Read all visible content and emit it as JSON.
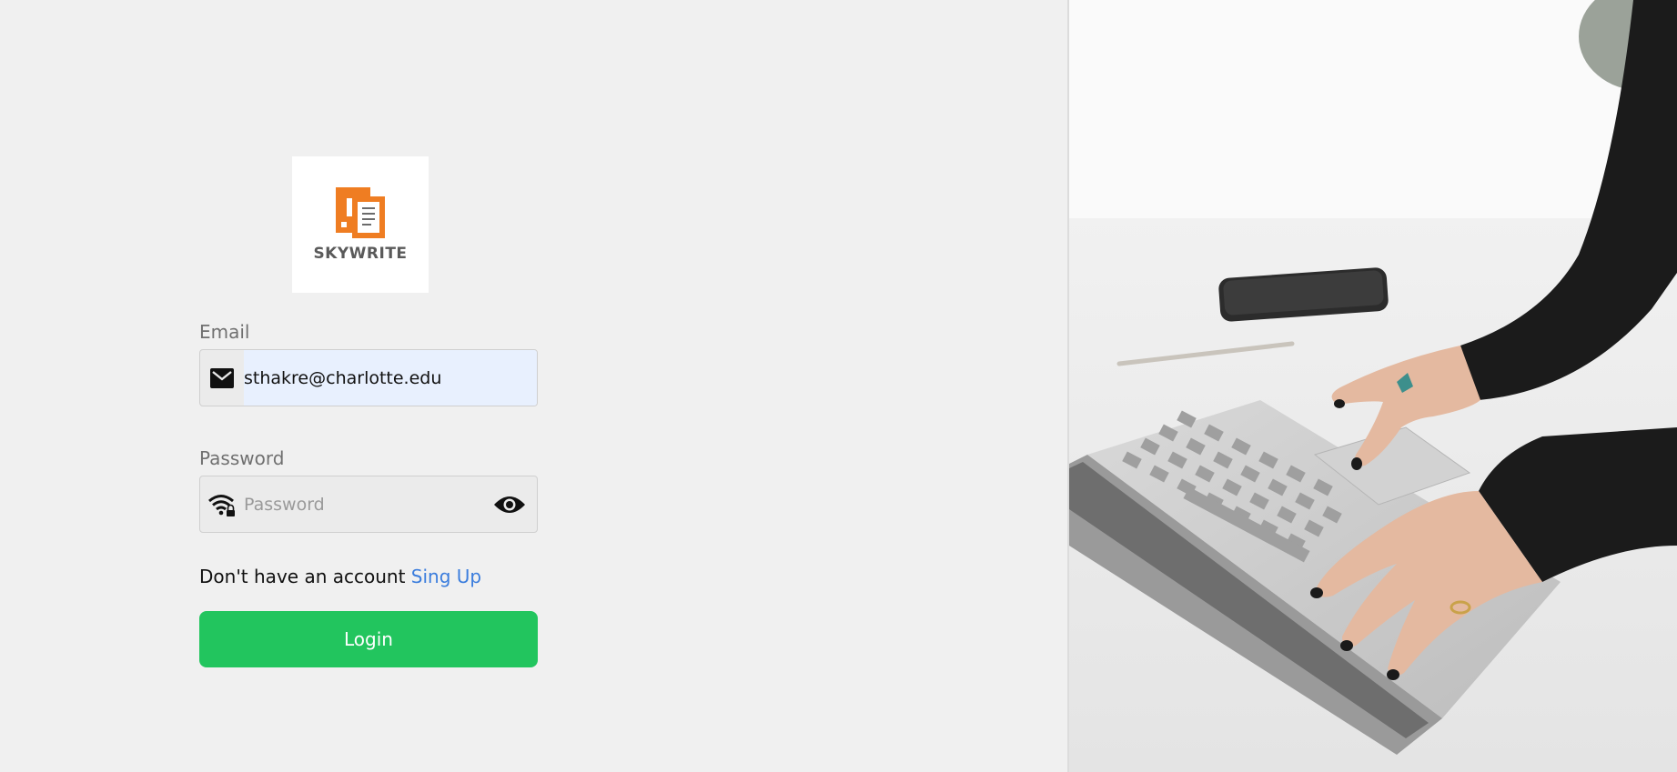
{
  "logo": {
    "text": "SKYWRITE",
    "color": "#ef7d22"
  },
  "email": {
    "label": "Email",
    "value": "sthakre@charlotte.edu",
    "icon": "mail-icon"
  },
  "password": {
    "label": "Password",
    "placeholder": "Password",
    "value": "",
    "icon": "wifi-lock-icon",
    "toggle_icon": "eye-icon"
  },
  "signup": {
    "prompt": "Don't have an account",
    "link_label": "Sing Up"
  },
  "login": {
    "label": "Login",
    "color": "#22c55e"
  },
  "hero_image": {
    "icon": "laptop-typing-photo"
  }
}
